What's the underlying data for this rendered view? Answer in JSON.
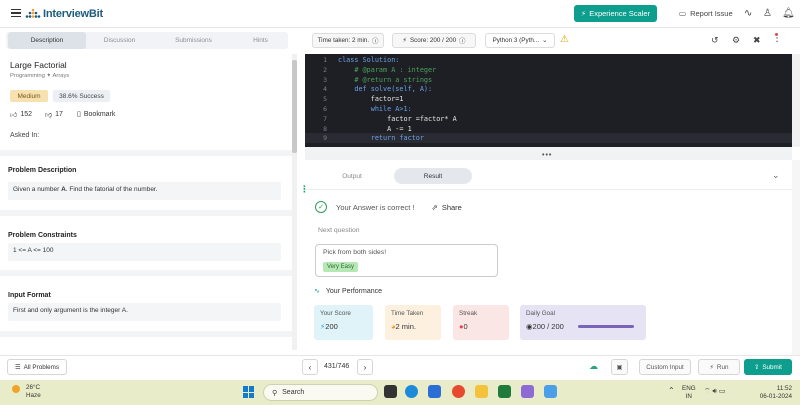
{
  "header": {
    "logo_text": "InterviewBit",
    "experience_button": "Experience Scaler",
    "report_issue": "Report Issue"
  },
  "left_tabs": [
    "Description",
    "Discussion",
    "Submissions",
    "Hints"
  ],
  "problem": {
    "title": "Large Factorial",
    "category": "Programming ✦ Arrays",
    "difficulty": "Medium",
    "success_rate": "38.6% Success",
    "upvotes": "152",
    "downvotes": "17",
    "bookmark": "Bookmark",
    "asked_in": "Asked In:"
  },
  "sections": [
    {
      "heading": "Problem Description",
      "body_pre": "Given a number ",
      "body_bold": "A",
      "body_post": ". Find the fatorial of the number."
    },
    {
      "heading": "Problem Constraints",
      "body": "1 <= A <= 100"
    },
    {
      "heading": "Input Format",
      "body": "First and only argument is the integer A."
    }
  ],
  "toolbar": {
    "time_taken": "Time taken: 2 min.",
    "score": "Score: 200 / 200",
    "language": "Python 3 (Pyth..."
  },
  "code": {
    "line_numbers": [
      "1",
      "2",
      "3",
      "4",
      "5",
      "6",
      "7",
      "8",
      "9"
    ],
    "lines": [
      "class Solution:",
      "    # @param A : integer",
      "    # @return a strings",
      "    def solve(self, A):",
      "        factor=1",
      "        while A>1:",
      "            factor =factor* A",
      "            A -= 1",
      "        return factor"
    ]
  },
  "result": {
    "tabs": [
      "Output",
      "Result"
    ],
    "correct_text": "Your Answer is correct !",
    "share": "Share",
    "next_question_label": "Next question",
    "next_card_title": "Pick from both sides!",
    "next_card_badge": "Very Easy",
    "performance_title": "Your Performance",
    "cards": [
      {
        "label": "Your Score",
        "value": "200",
        "bg": "#dff3f8"
      },
      {
        "label": "Time Taken",
        "value": "2 min.",
        "bg": "#fdf0df"
      },
      {
        "label": "Streak",
        "value": "0",
        "bg": "#fbe6e6"
      },
      {
        "label": "Daily Goal",
        "value": "200 / 200",
        "bg": "#e6e4f4"
      }
    ],
    "daily_goal_progress": 1.0
  },
  "bottom": {
    "all_problems": "All Problems",
    "page_counter": "431/746",
    "custom_input": "Custom Input",
    "run": "Run",
    "submit": "Submit"
  },
  "taskbar": {
    "temperature": "26°C",
    "weather": "Haze",
    "search": "Search",
    "lang_top": "ENG",
    "lang_bottom": "IN",
    "time": "11:52",
    "date": "06-01-2024"
  },
  "colors": {
    "accent": "#0d9e8d",
    "editor_bg": "#1e1f24",
    "taskbar_bg": "#e9ecc9"
  }
}
